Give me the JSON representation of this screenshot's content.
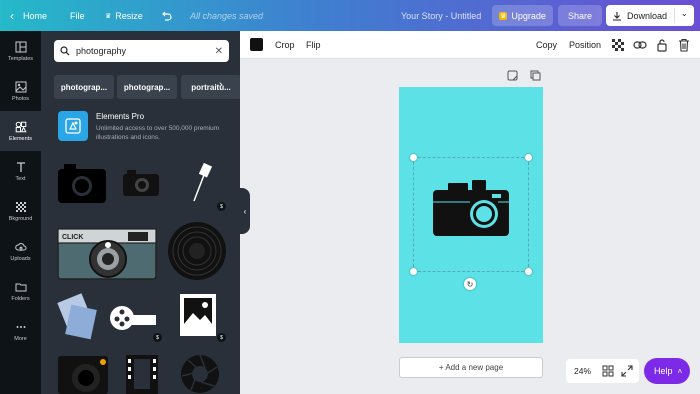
{
  "topbar": {
    "home": "Home",
    "file": "File",
    "resize": "Resize",
    "status": "All changes saved",
    "title": "Your Story - Untitled",
    "upgrade": "Upgrade",
    "share": "Share",
    "download": "Download"
  },
  "rail": {
    "items": [
      {
        "label": "Templates",
        "icon": "templates-icon"
      },
      {
        "label": "Photos",
        "icon": "photos-icon"
      },
      {
        "label": "Elements",
        "icon": "elements-icon"
      },
      {
        "label": "Text",
        "icon": "text-icon"
      },
      {
        "label": "Bkground",
        "icon": "background-icon"
      },
      {
        "label": "Uploads",
        "icon": "uploads-icon"
      },
      {
        "label": "Folders",
        "icon": "folders-icon"
      },
      {
        "label": "More",
        "icon": "more-icon"
      }
    ]
  },
  "panel": {
    "search_value": "photography",
    "chips": [
      "photograp...",
      "photograp...",
      "portraitu..."
    ],
    "elements_pro": {
      "title": "Elements Pro",
      "desc": "Unlimited access to over 500,000 premium illustrations and icons."
    },
    "badges": [
      "$",
      "$",
      "$"
    ]
  },
  "toolbar": {
    "crop": "Crop",
    "flip": "Flip",
    "copy": "Copy",
    "position": "Position"
  },
  "canvas": {
    "page_color": "#5ce1e6",
    "add_page": "+ Add a new page",
    "zoom": "24%"
  },
  "help": "Help",
  "colors": {
    "accent_purple": "#7d2ae8",
    "page_cyan": "#5ce1e6",
    "panel_bg": "#293039"
  }
}
